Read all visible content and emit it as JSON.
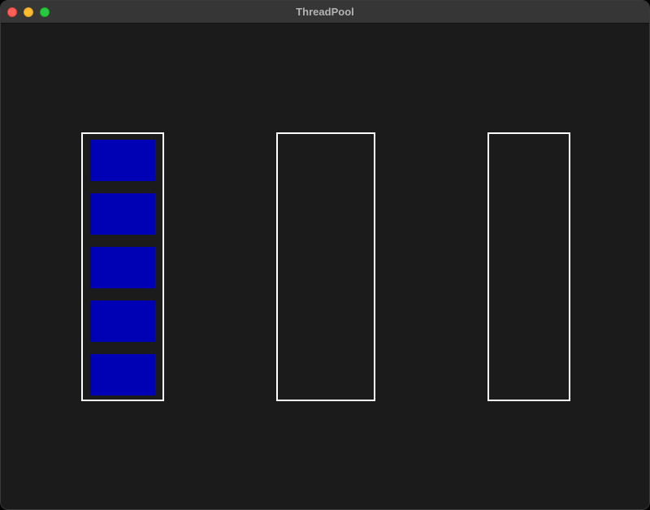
{
  "window": {
    "title": "ThreadPool",
    "controls": [
      "close",
      "minimize",
      "maximize"
    ]
  },
  "colors": {
    "background": "#1b1b1b",
    "titlebar": "#363636",
    "column_border": "#ffffff",
    "task_fill": "#0000b4"
  },
  "pool": {
    "threads": [
      {
        "task_count": 5
      },
      {
        "task_count": 0
      },
      {
        "task_count": 0
      }
    ]
  }
}
